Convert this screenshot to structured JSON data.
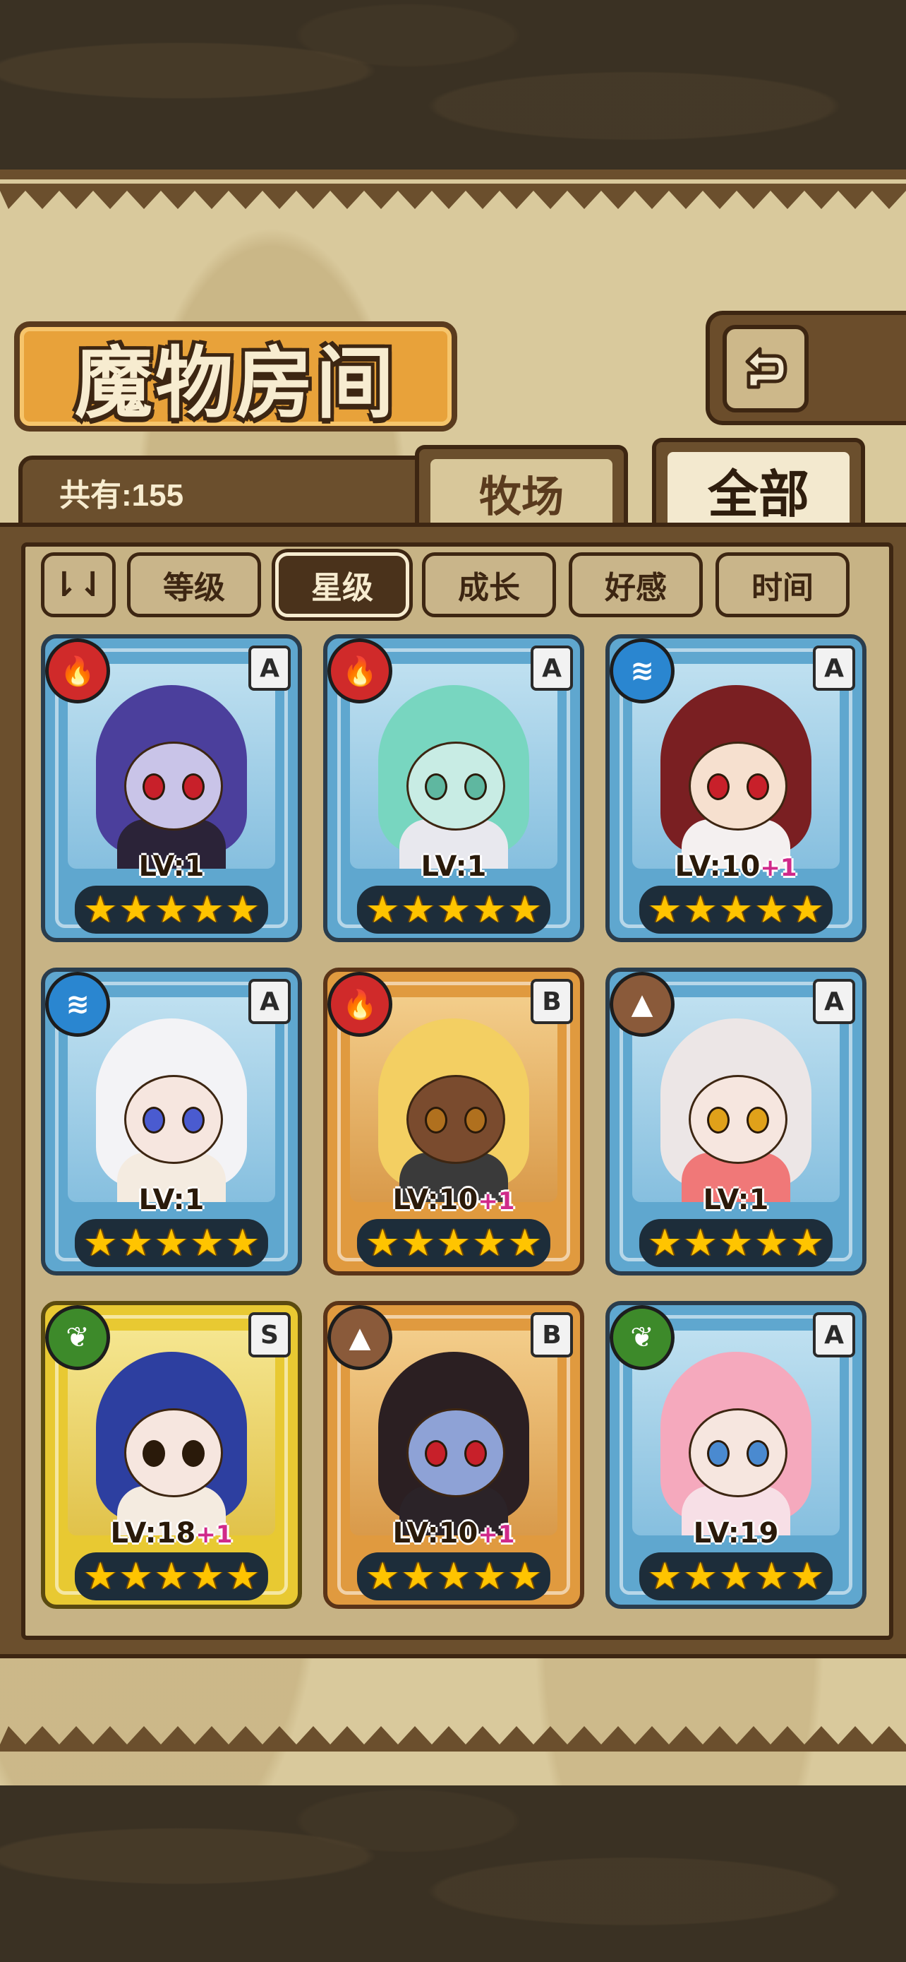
{
  "title": "魔物房间",
  "count_label": "共有:155",
  "tabs": [
    {
      "label": "牧场"
    },
    {
      "label": "全部"
    }
  ],
  "sort_buttons": [
    {
      "label": "等级"
    },
    {
      "label": "星级"
    },
    {
      "label": "成长"
    },
    {
      "label": "好感"
    },
    {
      "label": "时间"
    }
  ],
  "active_sort": "星级",
  "active_tab": "全部",
  "monsters": [
    {
      "element": "fire",
      "rarity": "A",
      "level": "LV:1",
      "bonus": "",
      "stars": 5,
      "hair": "#4b3f9c",
      "skin": "#c9c4e8",
      "eye": "#c8202a",
      "body": "#2b2338"
    },
    {
      "element": "fire",
      "rarity": "A",
      "level": "LV:1",
      "bonus": "",
      "stars": 5,
      "hair": "#78d6c0",
      "skin": "#c8ece4",
      "eye": "#5fb7a0",
      "body": "#e8e8ee"
    },
    {
      "element": "water",
      "rarity": "A",
      "level": "LV:10",
      "bonus": "+1",
      "stars": 5,
      "hair": "#7a1f22",
      "skin": "#f6e0cf",
      "eye": "#c8202a",
      "body": "#f4f0f0"
    },
    {
      "element": "water",
      "rarity": "A",
      "level": "LV:1",
      "bonus": "",
      "stars": 5,
      "hair": "#f3f3f6",
      "skin": "#f6e6df",
      "eye": "#4a5bd0",
      "body": "#f4ebe0"
    },
    {
      "element": "fire",
      "rarity": "B",
      "level": "LV:10",
      "bonus": "+1",
      "stars": 5,
      "hair": "#f3cf62",
      "skin": "#7a4b2e",
      "eye": "#b0701e",
      "body": "#3a3a3a"
    },
    {
      "element": "earth",
      "rarity": "A",
      "level": "LV:1",
      "bonus": "",
      "stars": 5,
      "hair": "#ece6e6",
      "skin": "#f6e6df",
      "eye": "#e0a11a",
      "body": "#f07878"
    },
    {
      "element": "nature",
      "rarity": "S",
      "level": "LV:18",
      "bonus": "+1",
      "stars": 5,
      "hair": "#2d3fa0",
      "skin": "#f6e6df",
      "eye": "#2a1a0a",
      "body": "#f4ebe0"
    },
    {
      "element": "earth",
      "rarity": "B",
      "level": "LV:10",
      "bonus": "+1",
      "stars": 5,
      "hair": "#2b1f22",
      "skin": "#8ea2d6",
      "eye": "#c8202a",
      "body": "#2b2328"
    },
    {
      "element": "nature",
      "rarity": "A",
      "level": "LV:19",
      "bonus": "",
      "stars": 5,
      "hair": "#f5a9bd",
      "skin": "#f6e6df",
      "eye": "#4a8ad0",
      "body": "#f7dfe6"
    }
  ],
  "icons": {
    "back": "return-arrow-icon",
    "sort_toggle": "sort-order-icon",
    "fire": "fire-element-icon",
    "water": "water-element-icon",
    "earth": "earth-element-icon",
    "nature": "leaf-element-icon",
    "star": "star-icon"
  }
}
